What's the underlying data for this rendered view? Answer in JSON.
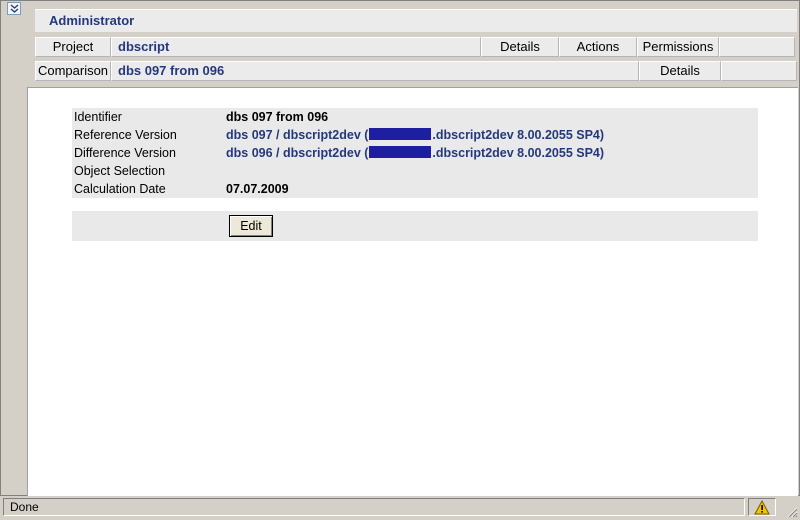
{
  "header": {
    "title": "Administrator"
  },
  "project_row": {
    "label": "Project",
    "value": "dbscript",
    "links": [
      "Details",
      "Actions",
      "Permissions"
    ]
  },
  "comparison_row": {
    "label": "Comparison",
    "value": "dbs 097 from 096",
    "links": [
      "Details"
    ]
  },
  "info": {
    "identifier": {
      "label": "Identifier",
      "value": "dbs 097 from 096"
    },
    "reference": {
      "label": "Reference Version",
      "value_pre": "dbs 097 / dbscript2dev (",
      "value_post": ".dbscript2dev 8.00.2055 SP4)"
    },
    "difference": {
      "label": "Difference Version",
      "value_pre": "dbs 096 / dbscript2dev (",
      "value_post": ".dbscript2dev 8.00.2055 SP4)"
    },
    "object_selection": {
      "label": "Object Selection",
      "value": ""
    },
    "calc_date": {
      "label": "Calculation Date",
      "value": "07.07.2009"
    }
  },
  "actions": {
    "edit_label": "Edit"
  },
  "status": {
    "text": "Done",
    "zone_icon": "warning-icon"
  },
  "colors": {
    "accent": "#23397a",
    "redaction": "#1d1fa0"
  }
}
